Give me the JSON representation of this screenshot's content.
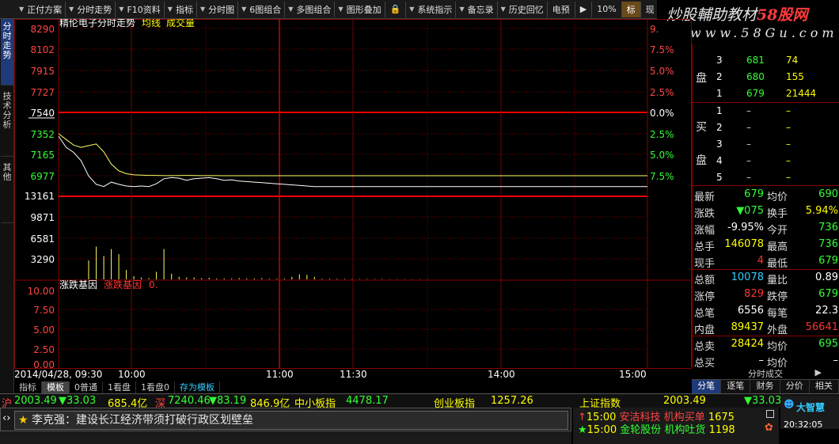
{
  "toolbar": [
    {
      "name": "scheme",
      "label": "正付方案",
      "arrow": true
    },
    {
      "name": "intraday",
      "label": "分时走势",
      "arrow": true
    },
    {
      "name": "f10",
      "label": "F10资料",
      "arrow": true
    },
    {
      "name": "indicator",
      "label": "指标",
      "arrow": true
    },
    {
      "name": "intraday-chart",
      "label": "分时图",
      "arrow": true
    },
    {
      "name": "six-combo",
      "label": "6图组合",
      "arrow": true
    },
    {
      "name": "multi-combo",
      "label": "多图组合",
      "arrow": true
    },
    {
      "name": "overlay",
      "label": "图形叠加",
      "arrow": true
    },
    {
      "name": "lock",
      "label": "🔒",
      "arrow": false
    },
    {
      "name": "sys-signal",
      "label": "系统指示",
      "arrow": true
    },
    {
      "name": "memo",
      "label": "备忘录",
      "arrow": true
    },
    {
      "name": "history",
      "label": "历史回忆",
      "arrow": true
    },
    {
      "name": "tele",
      "label": "电预",
      "arrow": false
    },
    {
      "name": "play",
      "label": "▶",
      "arrow": false
    },
    {
      "name": "zoom",
      "label": "10%",
      "arrow": false
    },
    {
      "name": "mark",
      "label": "标",
      "arrow": false,
      "active": true
    },
    {
      "name": "view",
      "label": "现",
      "arrow": false
    }
  ],
  "watermark": {
    "line1a": "炒股輔助教材",
    "line1b": "58股网",
    "line2": "www.58Gu.com"
  },
  "vtabs": [
    "分时走势",
    "技术分析",
    "其他"
  ],
  "chart": {
    "title": "精伦电子分时走势",
    "avg_label": "均线",
    "vol_label": "成交量",
    "price_labels": [
      "8290",
      "8102",
      "7915",
      "7727",
      "7540",
      "7352",
      "7165",
      "6977"
    ],
    "pct_labels": [
      "9.",
      "7.5%",
      "5.0%",
      "2.5%",
      "0.0%",
      "2.5%",
      "5.0%",
      "7.5%"
    ],
    "vol_labels": [
      "13161",
      "9871",
      "6581",
      "3290"
    ],
    "sub_title_a": "涨跌基因",
    "sub_title_b": "涨跌基因",
    "sub_title_c": "0.",
    "sub_labels": [
      "10.00",
      "7.50",
      "5.00",
      "2.50",
      "0.00"
    ],
    "time_labels": [
      "2014/04/28, 09:30",
      "10:00",
      "11:00",
      "11:30",
      "14:00",
      "15:00"
    ]
  },
  "chart_data": {
    "type": "line",
    "xlabel": "",
    "ylabel": "",
    "ylim": [
      6977,
      8290
    ],
    "series": [
      {
        "values": [
          7352,
          7300,
          7250,
          7230,
          7245,
          7260,
          7190,
          7080,
          7020,
          6995,
          6985,
          6982,
          6980,
          6980,
          6978,
          6978,
          6979,
          6980,
          6979,
          6978,
          6978,
          6978,
          6977,
          6977,
          6977,
          6977,
          6977,
          6977,
          6977,
          6977,
          6977,
          6977,
          6977,
          6977,
          6977,
          6977,
          6977,
          6977,
          6977,
          6977,
          6977,
          6977,
          6977,
          6977,
          6977,
          6977,
          6977,
          6977,
          6977,
          6977
        ]
      },
      {
        "values": [
          7330,
          7230,
          7185,
          7110,
          6975,
          6900,
          6880,
          6920,
          6900,
          6885,
          6880,
          6885,
          6880,
          6905,
          6950,
          6960,
          6955,
          6935,
          6950,
          6955,
          6960,
          6950,
          6935,
          6940,
          6930,
          6925,
          6920,
          6915,
          6910,
          6905,
          6900,
          6895,
          6890,
          6885,
          6880,
          6880,
          6880,
          6880,
          6880,
          6880,
          6880,
          6880,
          6880,
          6880,
          6880,
          6880,
          6880,
          6880,
          6880,
          6880
        ]
      }
    ],
    "volume": [
      0,
      0,
      0,
      0,
      3000,
      5200,
      3700,
      4800,
      4000,
      1500,
      500,
      300,
      200,
      1200,
      4800,
      900,
      400,
      300,
      300,
      200,
      250,
      150,
      150,
      150,
      200,
      150,
      150,
      200,
      100,
      100,
      120,
      400,
      800,
      700,
      400,
      100,
      100,
      100,
      80,
      60,
      60,
      60,
      60,
      60,
      40,
      40,
      40,
      40,
      40,
      40
    ]
  },
  "orders": {
    "sell": [
      {
        "n": "3",
        "p": "681",
        "v": "74"
      },
      {
        "n": "2",
        "p": "680",
        "v": "155"
      },
      {
        "n": "1",
        "p": "679",
        "v": "21444"
      }
    ],
    "sell_label": "盘",
    "buy": [
      {
        "n": "1",
        "p": "–",
        "v": "–"
      },
      {
        "n": "2",
        "p": "–",
        "v": "–"
      },
      {
        "n": "3",
        "p": "–",
        "v": "–"
      },
      {
        "n": "4",
        "p": "–",
        "v": "–"
      },
      {
        "n": "5",
        "p": "–",
        "v": "–"
      }
    ],
    "buy_label1": "买",
    "buy_label2": "盘"
  },
  "quotes": [
    {
      "l1": "最新",
      "v1": "679",
      "c1": "#33ff33",
      "l2": "均价",
      "v2": "690",
      "c2": "#33ff33"
    },
    {
      "l1": "涨跌",
      "v1": "▼075",
      "c1": "#33ff33",
      "l2": "换手",
      "v2": "5.94%",
      "c2": "#ffff00"
    },
    {
      "l1": "涨幅",
      "v1": "-9.95%",
      "c1": "#ffffff",
      "l2": "今开",
      "v2": "736",
      "c2": "#33ff33"
    },
    {
      "l1": "总手",
      "v1": "146078",
      "c1": "#ffff00",
      "l2": "最高",
      "v2": "736",
      "c2": "#33ff33"
    },
    {
      "l1": "现手",
      "v1": "4",
      "c1": "#ff3333",
      "l2": "最低",
      "v2": "679",
      "c2": "#33ff33"
    },
    {
      "l1": "总额",
      "v1": "10078",
      "c1": "#33ccff",
      "l2": "量比",
      "v2": "0.89",
      "c2": "#ffffff"
    },
    {
      "l1": "涨停",
      "v1": "829",
      "c1": "#ff3333",
      "l2": "跌停",
      "v2": "679",
      "c2": "#33ff33"
    },
    {
      "l1": "总笔",
      "v1": "6556",
      "c1": "#ffffff",
      "l2": "每笔",
      "v2": "22.3",
      "c2": "#ffffff"
    },
    {
      "l1": "内盘",
      "v1": "89437",
      "c1": "#ffff00",
      "l2": "外盘",
      "v2": "56641",
      "c2": "#ff3333"
    },
    {
      "l1": "总卖",
      "v1": "28424",
      "c1": "#ffff00",
      "l2": "均价",
      "v2": "695",
      "c2": "#33ff33"
    },
    {
      "l1": "总买",
      "v1": "–",
      "c1": "#ffffff",
      "l2": "均价",
      "v2": "–",
      "c2": "#ffffff"
    }
  ],
  "trades_label": "分时成交",
  "rtabs": [
    "分笔",
    "逐笔",
    "财务",
    "分价",
    "相关"
  ],
  "btabs": [
    "指标",
    "模板",
    "0普通",
    "1看盘",
    "1看盘0",
    "存为模板"
  ],
  "ticker": {
    "sh_label": "沪",
    "sh_val": "2003.49",
    "sh_chg": "▼33.03",
    "sh_amt": "685.4亿",
    "sz_label": "深",
    "sz_val": "7240.46",
    "sz_chg": "▼83.19",
    "sz_amt": "846.9亿",
    "sme_label": "中小板指",
    "sme_val": "4478.17",
    "gem_label": "创业板指",
    "gem_val": "1257.26",
    "idx_label": "上证指数",
    "idx_val": "2003.49",
    "idx_chg": "▼33.03"
  },
  "news": "李克强：建设长江经济带须打破行政区划壁垒",
  "alerts": [
    {
      "mark": "↑",
      "time": "15:00",
      "stock": "安洁科技",
      "event": "机构买单",
      "val": "1675"
    },
    {
      "mark": "★",
      "time": "15:00",
      "stock": "金轮股份",
      "event": "机构吐货",
      "val": "1198"
    }
  ],
  "logo": "大智慧",
  "clock": "20:32:05"
}
